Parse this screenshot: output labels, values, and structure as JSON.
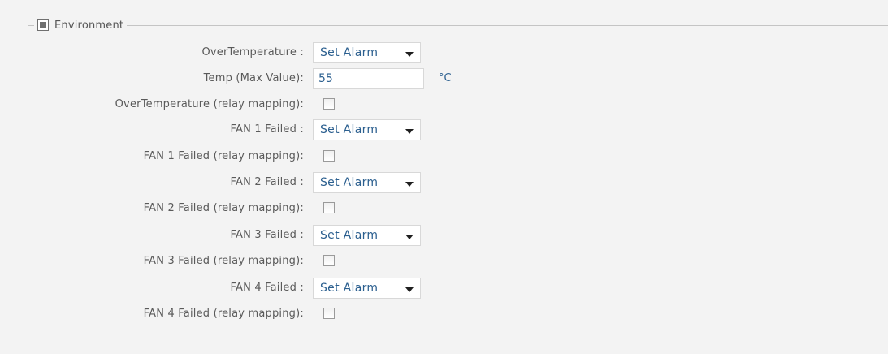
{
  "section": {
    "title": "Environment"
  },
  "overtemp": {
    "label": "OverTemperature :",
    "value": "Set Alarm"
  },
  "temp_max": {
    "label": "Temp (Max Value):",
    "value": "55",
    "unit": "°C"
  },
  "overtemp_relay": {
    "label": "OverTemperature (relay mapping):",
    "checked": false
  },
  "fans": [
    {
      "failed_label": "FAN 1 Failed :",
      "failed_value": "Set Alarm",
      "relay_label": "FAN 1 Failed (relay mapping):",
      "relay_checked": false
    },
    {
      "failed_label": "FAN 2 Failed :",
      "failed_value": "Set Alarm",
      "relay_label": "FAN 2 Failed (relay mapping):",
      "relay_checked": false
    },
    {
      "failed_label": "FAN 3 Failed :",
      "failed_value": "Set Alarm",
      "relay_label": "FAN 3 Failed (relay mapping):",
      "relay_checked": false
    },
    {
      "failed_label": "FAN 4 Failed :",
      "failed_value": "Set Alarm",
      "relay_label": "FAN 4 Failed (relay mapping):",
      "relay_checked": false
    }
  ],
  "icons": {
    "section_toggle": "collapse-box-icon",
    "dropdown": "caret-down-icon"
  },
  "colors": {
    "background": "#f3f3f3",
    "label_text": "#5a5a5a",
    "value_text": "#2b5f8f",
    "border": "#c4c4c4"
  }
}
